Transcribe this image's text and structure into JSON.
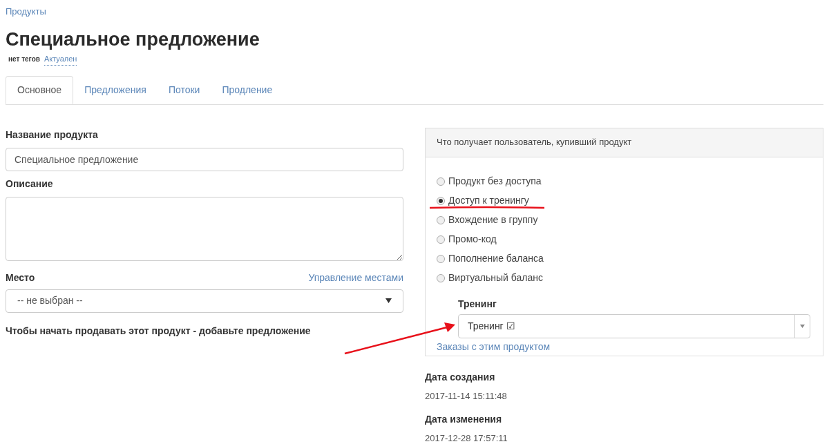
{
  "breadcrumb": "Продукты",
  "title": "Специальное предложение",
  "tags": {
    "label": "нет тегов",
    "status": "Актуален"
  },
  "tabs": [
    {
      "label": "Основное",
      "selected": true
    },
    {
      "label": "Предложения",
      "selected": false
    },
    {
      "label": "Потоки",
      "selected": false
    },
    {
      "label": "Продление",
      "selected": false
    }
  ],
  "form": {
    "name_label": "Название продукта",
    "name_value": "Специальное предложение",
    "description_label": "Описание",
    "place_label": "Место",
    "place_link": "Управление местами",
    "place_value": "-- не выбран --",
    "notice": "Чтобы начать продавать этот продукт - добавьте предложение"
  },
  "panel": {
    "header": "Что получает пользователь, купивший продукт",
    "options": [
      {
        "label": "Продукт без доступа",
        "selected": false
      },
      {
        "label": "Доступ к тренингу",
        "selected": true
      },
      {
        "label": "Вхождение в группу",
        "selected": false
      },
      {
        "label": "Промо-код",
        "selected": false
      },
      {
        "label": "Пополнение баланса",
        "selected": false
      },
      {
        "label": "Виртуальный баланс",
        "selected": false
      }
    ],
    "training_label": "Тренинг",
    "training_value": "Тренинг ☑",
    "orders_link": "Заказы с этим продуктом"
  },
  "dates": [
    {
      "label": "Дата создания",
      "value": "2017-11-14 15:11:48"
    },
    {
      "label": "Дата изменения",
      "value": "2017-12-28 17:57:11"
    }
  ]
}
